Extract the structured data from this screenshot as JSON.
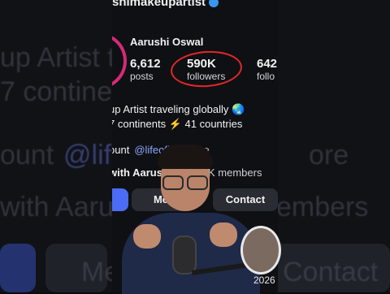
{
  "background": {
    "ghost_lines": [
      "up Artist tr",
      "7 continen",
      "ount",
      "@life",
      "ore",
      "with Aarus",
      "embers",
      "Me",
      "Contact"
    ]
  },
  "profile": {
    "handle": "shimakeupartist",
    "name": "Aarushi Oswal",
    "stats": [
      {
        "value": "6,612",
        "label": "posts"
      },
      {
        "value": "590K",
        "label": "followers"
      },
      {
        "value": "642",
        "label": "follo"
      }
    ],
    "bio_line1": "up Artist traveling globally 🌏",
    "bio_line2": "7 continents ⚡ 41 countries",
    "link_prefix": "ount",
    "link_handle": "@lifeof",
    "link_handle_tail": "hi",
    "more_label": "more",
    "members_prefix": "with Aarus",
    "members_count": "K members",
    "buttons": {
      "follow": "",
      "message": "Me",
      "contact": "Contact"
    }
  },
  "overlay": {
    "year": "2026"
  },
  "colors": {
    "accent_blue": "#4a6cf7",
    "annotation_red": "#e0272b",
    "story_ring": "#d62976"
  }
}
